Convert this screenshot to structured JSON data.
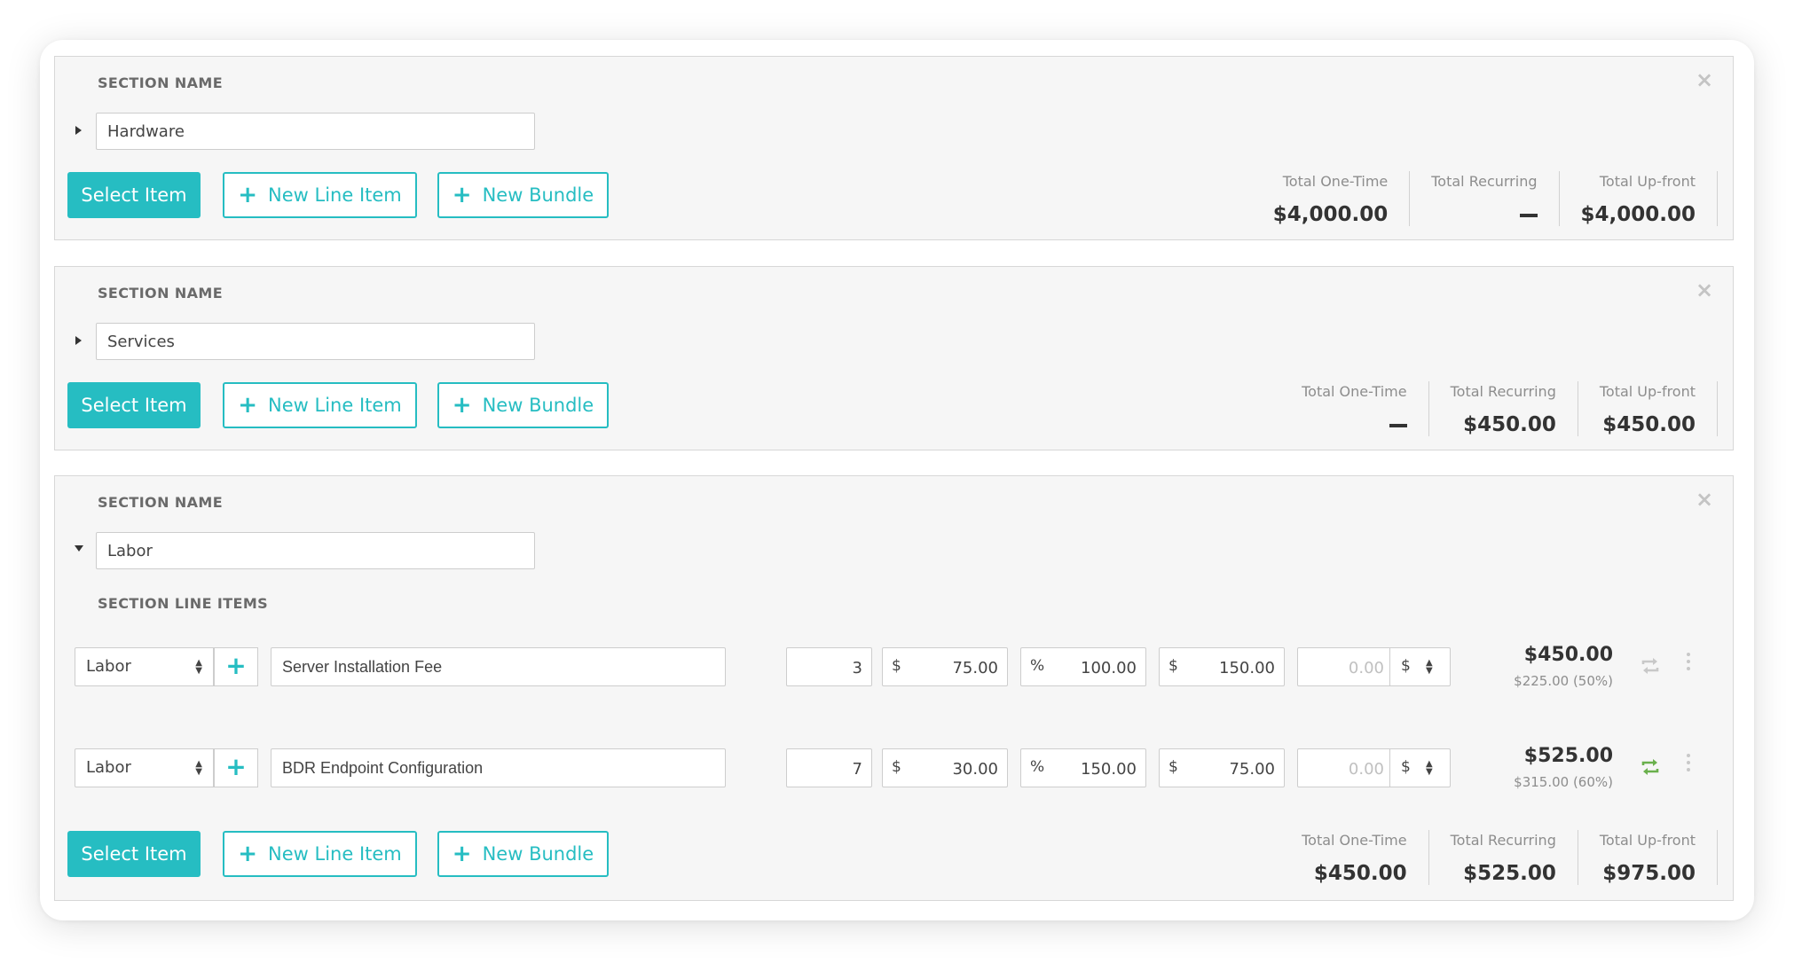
{
  "colors": {
    "accent": "#26bdc2",
    "recurring_active": "#6ab04c",
    "recurring_inactive": "#c8c8c8"
  },
  "icons": {
    "close": "close-icon",
    "collapse": "caret-icon",
    "add": "plus-icon",
    "recurring": "recurring-icon",
    "menu": "more-vertical-icon"
  },
  "sections": [
    {
      "label": "SECTION NAME",
      "name": "Hardware",
      "buttons": {
        "select": "Select Item",
        "new_line_item": "New Line Item",
        "new_bundle": "New Bundle"
      },
      "totals": [
        {
          "label": "Total One-Time",
          "value": "$4,000.00"
        },
        {
          "label": "Total Recurring",
          "value": ""
        },
        {
          "label": "Total Up-front",
          "value": "$4,000.00"
        }
      ]
    },
    {
      "label": "SECTION NAME",
      "name": "Services",
      "buttons": {
        "select": "Select Item",
        "new_line_item": "New Line Item",
        "new_bundle": "New Bundle"
      },
      "totals": [
        {
          "label": "Total One-Time",
          "value": ""
        },
        {
          "label": "Total Recurring",
          "value": "$450.00"
        },
        {
          "label": "Total Up-front",
          "value": "$450.00"
        }
      ]
    },
    {
      "label": "SECTION NAME",
      "name": "Labor",
      "line_items_label": "SECTION LINE ITEMS",
      "line_items": [
        {
          "category": "Labor",
          "description": "Server Installation Fee",
          "quantity": "3",
          "cost_prefix": "$",
          "cost": "75.00",
          "markup_prefix": "%",
          "markup": "100.00",
          "price_prefix": "$",
          "price": "150.00",
          "discount": "0.00",
          "discount_prefix": "$",
          "total": "$450.00",
          "subtotal": "$225.00 (50%)",
          "recurring": false
        },
        {
          "category": "Labor",
          "description": "BDR Endpoint Configuration",
          "quantity": "7",
          "cost_prefix": "$",
          "cost": "30.00",
          "markup_prefix": "%",
          "markup": "150.00",
          "price_prefix": "$",
          "price": "75.00",
          "discount": "0.00",
          "discount_prefix": "$",
          "total": "$525.00",
          "subtotal": "$315.00 (60%)",
          "recurring": true
        }
      ],
      "buttons": {
        "select": "Select Item",
        "new_line_item": "New Line Item",
        "new_bundle": "New Bundle"
      },
      "totals": [
        {
          "label": "Total One-Time",
          "value": "$450.00"
        },
        {
          "label": "Total Recurring",
          "value": "$525.00"
        },
        {
          "label": "Total Up-front",
          "value": "$975.00"
        }
      ]
    }
  ]
}
